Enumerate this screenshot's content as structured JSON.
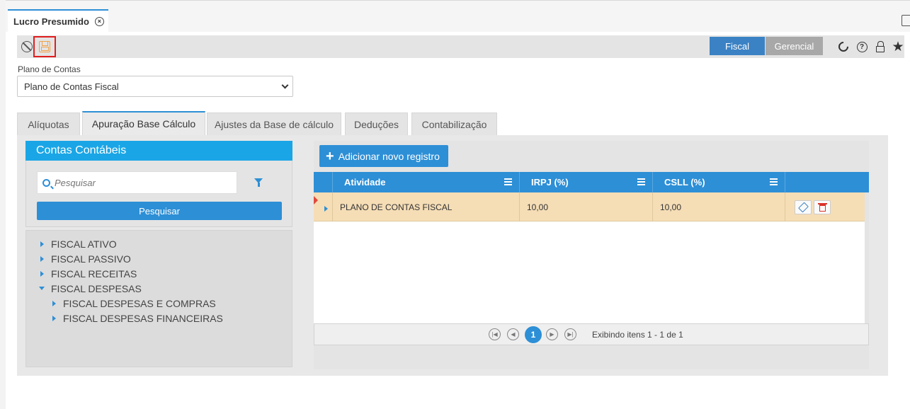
{
  "doc_tab": {
    "title": "Lucro Presumido",
    "close_glyph": "×"
  },
  "toolbar": {
    "modes": [
      "Fiscal",
      "Gerencial"
    ],
    "active_mode": "Fiscal",
    "help_glyph": "?",
    "star_glyph": "★"
  },
  "plano": {
    "label": "Plano de Contas",
    "selected": "Plano de Contas Fiscal"
  },
  "tabs": [
    {
      "label": "Alíquotas"
    },
    {
      "label": "Apuração Base Cálculo",
      "active": true
    },
    {
      "label": "Ajustes da Base de cálculo"
    },
    {
      "label": "Deduções"
    },
    {
      "label": "Contabilização"
    }
  ],
  "contas": {
    "title": "Contas Contábeis",
    "search_placeholder": "Pesquisar",
    "search_button": "Pesquisar",
    "tree": [
      {
        "label": "FISCAL ATIVO",
        "level": 0,
        "expanded": false
      },
      {
        "label": "FISCAL PASSIVO",
        "level": 0,
        "expanded": false
      },
      {
        "label": "FISCAL RECEITAS",
        "level": 0,
        "expanded": false
      },
      {
        "label": "FISCAL DESPESAS",
        "level": 0,
        "expanded": true
      },
      {
        "label": "FISCAL DESPESAS E COMPRAS",
        "level": 1,
        "expanded": false
      },
      {
        "label": "FISCAL DESPESAS FINANCEIRAS",
        "level": 1,
        "expanded": false
      }
    ]
  },
  "grid": {
    "add_button": "Adicionar novo registro",
    "add_glyph": "+",
    "columns": [
      "Atividade",
      "IRPJ (%)",
      "CSLL (%)"
    ],
    "rows": [
      {
        "atividade": "PLANO DE CONTAS FISCAL",
        "irpj": "10,00",
        "csll": "10,00"
      }
    ],
    "pager": {
      "current": "1",
      "info": "Exibindo itens 1 - 1 de 1"
    }
  },
  "colors": {
    "accent": "#2d8fd6",
    "panel_header": "#1aa6e6",
    "row_selected": "#f5ddb6",
    "mode_active": "#3b82c4",
    "mode_inactive": "#a8a8a8"
  },
  "icons": [
    "close-icon",
    "cancel-icon",
    "save-icon",
    "refresh-icon",
    "help-icon",
    "lock-icon",
    "star-icon",
    "search-icon",
    "filter-icon",
    "edit-icon",
    "delete-icon"
  ]
}
